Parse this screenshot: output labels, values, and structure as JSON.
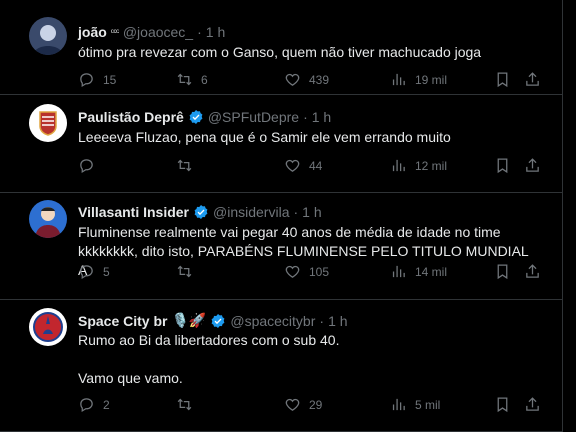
{
  "tweets": [
    {
      "name": "joão",
      "name_suffix": "ᶜᶜᶜ",
      "handle": "@joaocec_",
      "time": "1 h",
      "text": "ótimo pra revezar com o Ganso, quem não tiver machucado joga",
      "replies": "15",
      "retweets": "6",
      "likes": "439",
      "views": "19 mil",
      "verified": false
    },
    {
      "name": "Paulistão Deprê",
      "handle": "@SPFutDepre",
      "time": "1 h",
      "text": "Leeeeva Fluzao, pena que é o Samir ele vem errando muito",
      "replies": "",
      "retweets": "",
      "likes": "44",
      "views": "12 mil",
      "verified": true
    },
    {
      "name": "Villasanti Insider",
      "handle": "@insidervila",
      "time": "1 h",
      "text": "Fluminense realmente vai pegar 40 anos de média de idade no time\nkkkkkkkk, dito isto, PARABÉNS FLUMINENSE PELO TITULO MUNDIAL A",
      "replies": "5",
      "retweets": "",
      "likes": "105",
      "views": "14 mil",
      "verified": true
    },
    {
      "name": "Space City br",
      "name_suffix": "🎙️🚀",
      "handle": "@spacecitybr",
      "time": "1 h",
      "text": "Rumo ao Bi da libertadores com o sub 40.\n\nVamo que vamo.",
      "replies": "2",
      "retweets": "",
      "likes": "29",
      "views": "5 mil",
      "verified": true
    }
  ],
  "dot": "·",
  "icons": [
    "reply-icon",
    "retweet-icon",
    "like-icon",
    "views-icon",
    "bookmark-icon",
    "share-icon",
    "verified-icon"
  ],
  "colors": {
    "background": "#000000",
    "text": "#e7e9ea",
    "muted": "#71767b",
    "verified": "#1d9bf0",
    "border": "#2f3336"
  }
}
